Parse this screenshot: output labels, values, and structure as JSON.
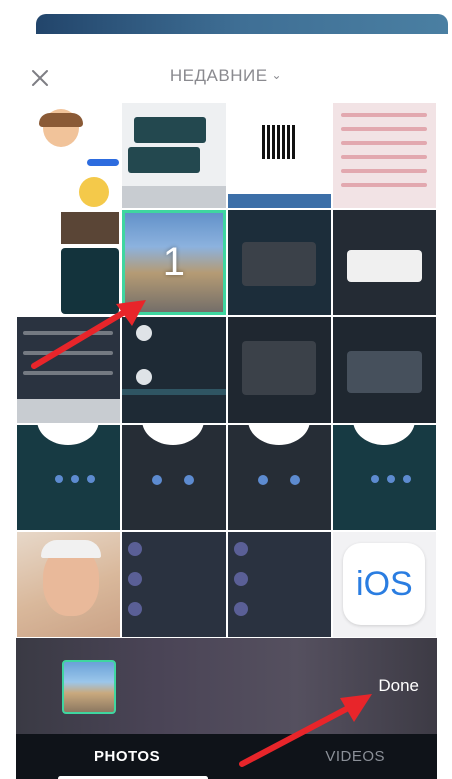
{
  "header": {
    "album_title": "НЕДАВНИЕ",
    "close_icon": "close-icon",
    "chevron_icon": "chevron-down-icon"
  },
  "grid": {
    "selected_number": "1",
    "ios_label": "iOS"
  },
  "footer": {
    "done_label": "Done",
    "tabs": [
      {
        "label": "PHOTOS",
        "selected": true
      },
      {
        "label": "VIDEOS",
        "selected": false
      }
    ]
  },
  "colors": {
    "accent": "#3fd6a0",
    "annotation_arrow": "#e8252a",
    "tab_bar": "#0f1319"
  }
}
